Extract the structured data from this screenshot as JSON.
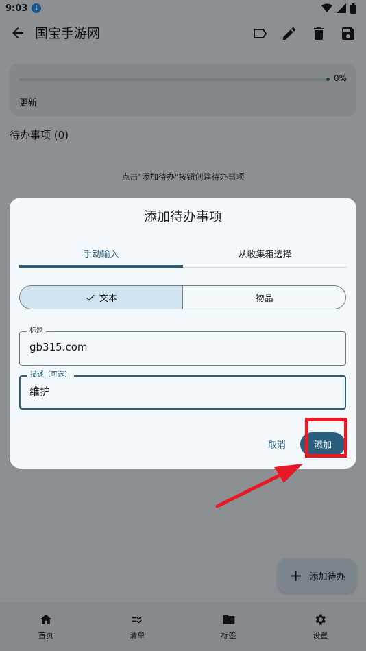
{
  "status_bar": {
    "time": "9:03"
  },
  "app_bar": {
    "title": "国宝手游网"
  },
  "progress": {
    "value_percent": 0,
    "percent_label": "0%",
    "label": "更新"
  },
  "todo_section": {
    "heading": "待办事项 (0)",
    "empty_hint": "点击\"添加待办\"按钮创建待办事项"
  },
  "fab": {
    "label": "添加待办"
  },
  "bottom_nav": [
    {
      "label": "首页",
      "icon": "home-icon"
    },
    {
      "label": "清单",
      "icon": "checklist-icon"
    },
    {
      "label": "标签",
      "icon": "folder-icon"
    },
    {
      "label": "设置",
      "icon": "gear-icon"
    }
  ],
  "dialog": {
    "title": "添加待办事项",
    "tabs": [
      {
        "label": "手动输入",
        "active": true
      },
      {
        "label": "从收集箱选择",
        "active": false
      }
    ],
    "segments": [
      {
        "label": "文本",
        "selected": true
      },
      {
        "label": "物品",
        "selected": false
      }
    ],
    "title_field": {
      "label": "标题",
      "value": "gb315.com"
    },
    "desc_field": {
      "label": "描述（可选）",
      "value": "维护"
    },
    "cancel_label": "取消",
    "add_label": "添加"
  },
  "colors": {
    "accent": "#2a5e7d",
    "highlight": "#e51a24"
  }
}
